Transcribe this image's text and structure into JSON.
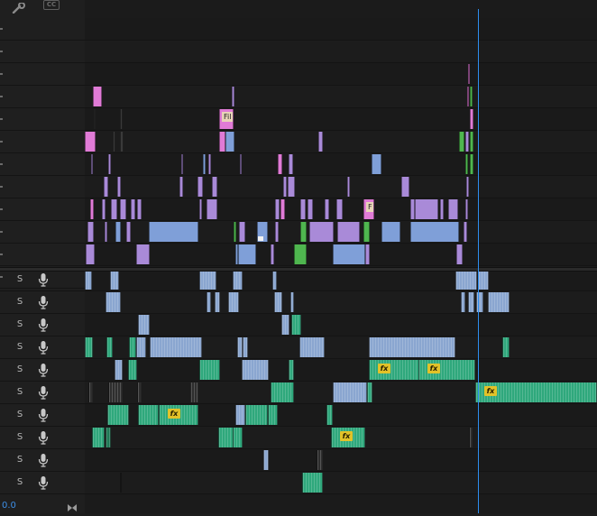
{
  "toolbar": {
    "wrench_icon": "wrench-icon",
    "captions_label": "CC"
  },
  "timeline": {
    "zoom_readout": "0.0",
    "playhead_color": "#2d8ef0",
    "video_track_count": 12,
    "audio_track_count": 10
  },
  "audio_tracks": [
    {
      "solo": "S",
      "mic_icon": "microphone-icon"
    },
    {
      "solo": "S",
      "mic_icon": "microphone-icon"
    },
    {
      "solo": "S",
      "mic_icon": "microphone-icon"
    },
    {
      "solo": "S",
      "mic_icon": "microphone-icon"
    },
    {
      "solo": "S",
      "mic_icon": "microphone-icon"
    },
    {
      "solo": "S",
      "mic_icon": "microphone-icon"
    },
    {
      "solo": "S",
      "mic_icon": "microphone-icon"
    },
    {
      "solo": "S",
      "mic_icon": "microphone-icon"
    },
    {
      "solo": "S",
      "mic_icon": "microphone-icon"
    },
    {
      "solo": "S",
      "mic_icon": "microphone-icon"
    }
  ],
  "clip_labels": {
    "v9": "Fil",
    "v4": "F"
  },
  "colors": {
    "video_pink": "#e07bd6",
    "video_purple": "#a98ad8",
    "video_blue": "#7f9fd8",
    "video_green": "#4fb64f",
    "audio_green": "#2fa87c",
    "audio_blue": "#8aa6d0",
    "work_area_yellow": "#e6d51f",
    "work_area_green": "#3fbf3f",
    "fx_badge": "#e2c229"
  }
}
